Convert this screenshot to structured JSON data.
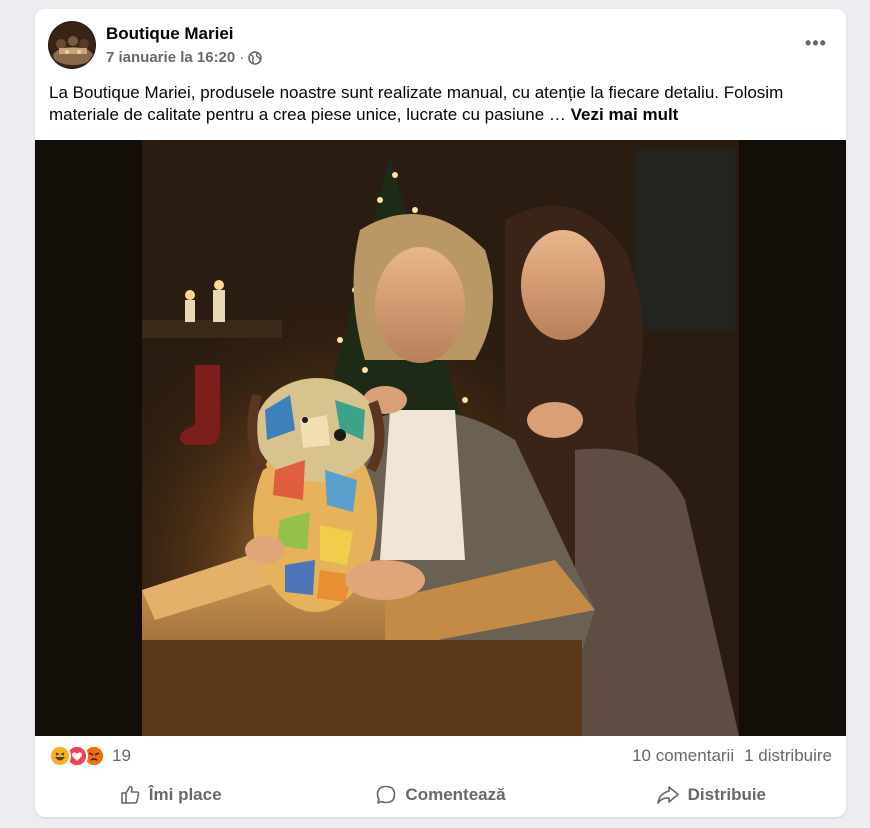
{
  "post": {
    "author": "Boutique Mariei",
    "timestamp": "7 ianuarie la 16:20",
    "separator": "·",
    "privacy_icon": "globe-icon",
    "more_label": "•••",
    "caption_text": "La Boutique Mariei, produsele noastre sunt realizate manual, cu atenție la fiecare detaliu. Folosim materiale de calitate pentru a crea piese unice, lucrate cu pasiune … ",
    "see_more_label": "Vezi mai mult"
  },
  "photo": {
    "alt": "Two women opening a box with a glowing stained-glass dog lamp in front of a Christmas tree"
  },
  "reactions": {
    "types": [
      "haha-icon",
      "love-icon",
      "angry-icon"
    ],
    "count": "19",
    "comments": "10 comentarii",
    "shares": "1 distribuire"
  },
  "actions": {
    "like_label": "Îmi place",
    "comment_label": "Comentează",
    "share_label": "Distribuie"
  },
  "colors": {
    "background": "#ecedf0",
    "card": "#ffffff",
    "secondary_text": "#65686c",
    "love": "#f33e58",
    "haha": "#f7b125",
    "angry": "#e9710f"
  }
}
